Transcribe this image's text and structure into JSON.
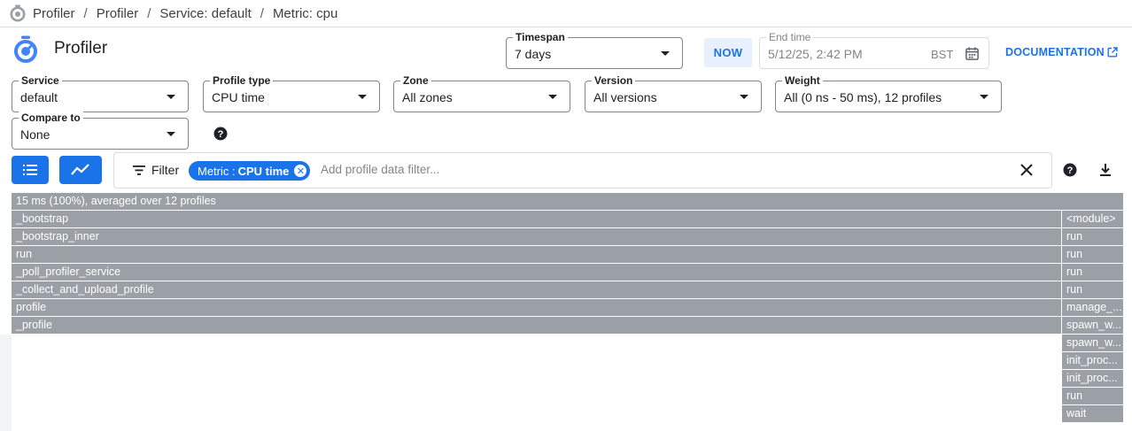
{
  "breadcrumb": [
    "Profiler",
    "Profiler",
    "Service: default",
    "Metric: cpu"
  ],
  "app_title": "Profiler",
  "timespan": {
    "label": "Timespan",
    "value": "7 days"
  },
  "now_label": "NOW",
  "end_time": {
    "label": "End time",
    "value": "5/12/25, 2:42 PM",
    "tz": "BST"
  },
  "documentation_label": "DOCUMENTATION",
  "filters": {
    "service": {
      "label": "Service",
      "value": "default"
    },
    "profile_type": {
      "label": "Profile type",
      "value": "CPU time"
    },
    "zone": {
      "label": "Zone",
      "value": "All zones"
    },
    "version": {
      "label": "Version",
      "value": "All versions"
    },
    "weight": {
      "label": "Weight",
      "value": "All (0 ns - 50 ms), 12 profiles"
    },
    "compare_to": {
      "label": "Compare to",
      "value": "None"
    }
  },
  "filter_bar": {
    "label": "Filter",
    "chip_key": "Metric :",
    "chip_value": "CPU time",
    "placeholder": "Add profile data filter..."
  },
  "flame": {
    "root": "15 ms (100%), averaged over 12 profiles",
    "left_stack": [
      "_bootstrap",
      "_bootstrap_inner",
      "run",
      "_poll_profiler_service",
      "_collect_and_upload_profile",
      "profile",
      "_profile"
    ],
    "right_stack": [
      "<module>",
      "run",
      "run",
      "run",
      "run",
      "manage_...",
      "spawn_w...",
      "spawn_w...",
      "init_proc...",
      "init_proc...",
      "run",
      "wait"
    ]
  },
  "colors": {
    "accent": "#1a73e8",
    "frame": "#9aa0a6"
  }
}
